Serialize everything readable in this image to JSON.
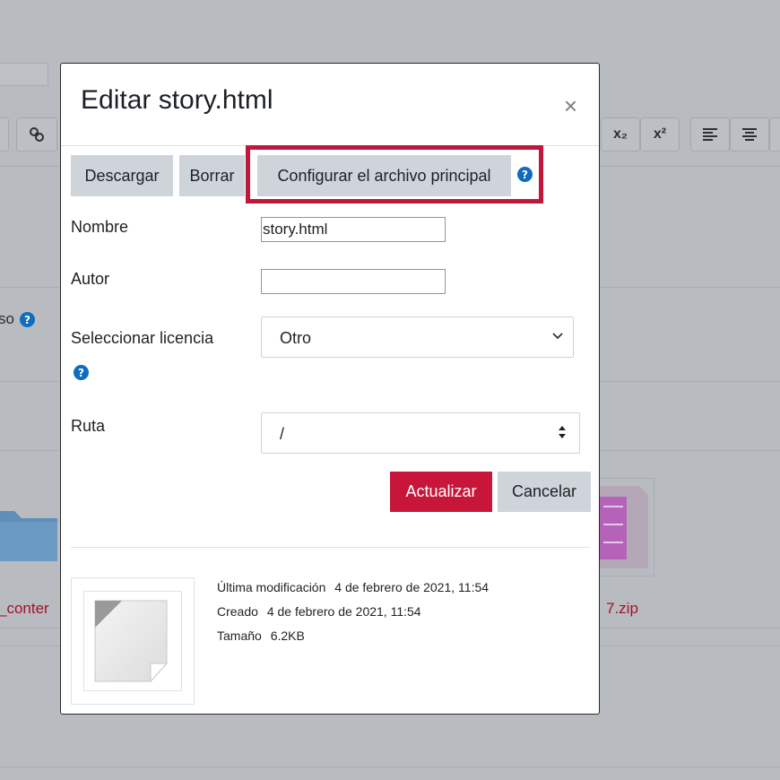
{
  "background": {
    "partial_label": "so",
    "folder_link_partial": "_conter",
    "zip_link_partial": "7.zip",
    "toolbar": {
      "subscript_label": "x₂",
      "superscript_label": "x²"
    }
  },
  "modal": {
    "title": "Editar story.html",
    "close_label": "×",
    "actions": {
      "download": "Descargar",
      "delete": "Borrar",
      "set_main": "Configurar el archivo principal"
    },
    "help_glyph": "?",
    "fields": {
      "name_label": "Nombre",
      "name_value": "story.html",
      "author_label": "Autor",
      "author_value": "",
      "license_label": "Seleccionar licencia",
      "license_value": "Otro",
      "path_label": "Ruta",
      "path_value": "/"
    },
    "buttons": {
      "update": "Actualizar",
      "cancel": "Cancelar"
    },
    "file_info": {
      "modified_label": "Última modificación",
      "modified_value": "4 de febrero de 2021, 11:54",
      "created_label": "Creado",
      "created_value": "4 de febrero de 2021, 11:54",
      "size_label": "Tamaño",
      "size_value": "6.2KB"
    }
  },
  "colors": {
    "primary": "#c8163a",
    "highlight": "#c0173a",
    "help": "#0f6cbf",
    "secondary_button": "#ced4da"
  }
}
